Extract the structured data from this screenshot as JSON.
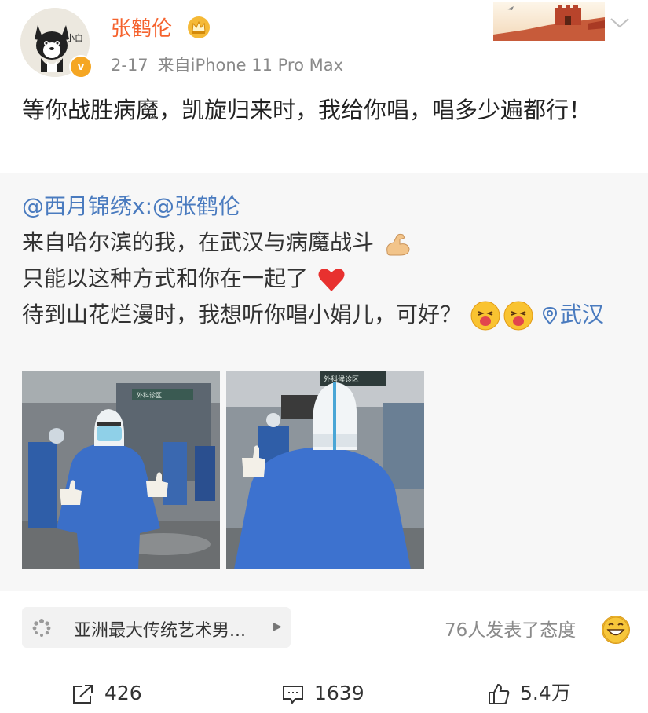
{
  "post": {
    "username": "张鹤伦",
    "avatar_text": "小白",
    "verified_badge": "v",
    "date": "2-17",
    "source": "来自iPhone 11 Pro Max",
    "text": "等你战胜病魔，凯旋归来时，我给你唱，唱多少遍都行！"
  },
  "repost": {
    "author": "@西月锦绣",
    "separator": "x:",
    "mention": "@张鹤伦",
    "line1": "来自哈尔滨的我，在武汉与病魔战斗",
    "line2": "只能以这种方式和你在一起了",
    "line3": "待到山花烂漫时，我想听你唱小娟儿，可好？",
    "location": "武汉",
    "photo_signs": [
      "外科诊区",
      "外科候诊区"
    ]
  },
  "topic": {
    "label": "亚洲最大传统艺术男...",
    "icon": "loading-icon"
  },
  "attitude": {
    "text": "76人发表了态度",
    "icon": "grin-emoji-icon"
  },
  "actions": {
    "repost_count": "426",
    "comment_count": "1639",
    "like_count": "5.4万"
  },
  "colors": {
    "username": "#f5622d",
    "link": "#4a7bbf",
    "meta": "#8a8a8a",
    "repost_bg": "#f7f7f7",
    "verified": "#f5a623"
  }
}
